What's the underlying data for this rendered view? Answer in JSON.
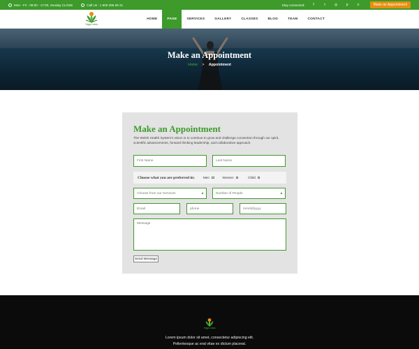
{
  "topbar": {
    "hours": "Mon - Fri : 09:00 - 17:00, Sunday CLOSE",
    "phone": "Call Us : 1 800 365 59 21",
    "stay_connected": "Stay connected:",
    "social": [
      "f",
      "t",
      "◎",
      "p",
      "≡"
    ],
    "appointment_button": "Make an Appointment",
    "accent_color": "#3d9a2b",
    "button_color": "#e58f0f"
  },
  "brand": {
    "logo_text": "Yoga Lotus"
  },
  "nav": {
    "items": [
      "HOME",
      "PAGE",
      "SERVICES",
      "GALLERY",
      "CLASSES",
      "BLOG",
      "TEAM",
      "CONTACT"
    ],
    "active": "PAGE"
  },
  "hero": {
    "title": "Make an Appointment",
    "breadcrumb_home": "Home",
    "breadcrumb_sep": ">",
    "breadcrumb_current": "Appointment"
  },
  "form": {
    "title": "Make an Appointment",
    "description": "The Welsh Health System's vision is to continue to grow and challenge convention through our spirit, scientific advancements, forward thinking leadership, and collaborative approach.",
    "first_name_placeholder": "First Name",
    "last_name_placeholder": "Last Name",
    "preference_label": "Choose what you are preferred in:",
    "preference_options": [
      "Men",
      "Women",
      "Child"
    ],
    "service_select": "Choose from our Services",
    "people_select": "Number of People",
    "email_placeholder": "Email",
    "phone_placeholder": "phone",
    "date_placeholder": "mm/dd/yyyy",
    "message_placeholder": "Message",
    "send_button": "Send Message"
  },
  "footer": {
    "logo_text": "Yoga Lotus",
    "line1": "Lorem ipsum dolor sit amet, consectetur adipiscing elit.",
    "line2": "Pellentesque ac erat vitae ex dictum placerat."
  }
}
